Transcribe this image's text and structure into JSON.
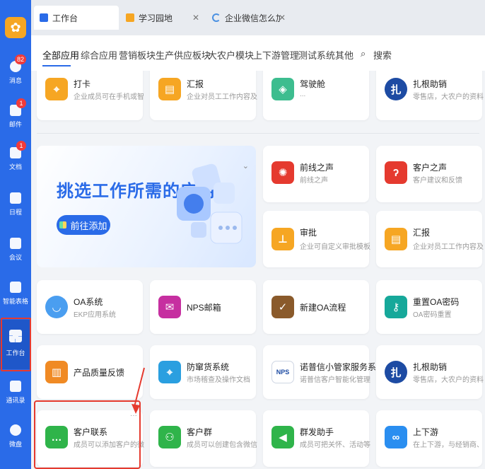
{
  "rail": {
    "items": [
      {
        "label": "消息",
        "badge": "82"
      },
      {
        "label": "邮件",
        "badge": "1"
      },
      {
        "label": "文档",
        "badge": "1"
      },
      {
        "label": "日程",
        "badge": ""
      },
      {
        "label": "会议",
        "badge": ""
      },
      {
        "label": "智能表格",
        "badge": ""
      },
      {
        "label": "工作台",
        "badge": ""
      },
      {
        "label": "通讯录",
        "badge": ""
      },
      {
        "label": "微盘",
        "badge": ""
      }
    ]
  },
  "tabs": [
    {
      "label": "工作台",
      "icon": "grid-icon",
      "color": "#2a6be8"
    },
    {
      "label": "学习园地",
      "icon": "app-icon",
      "color": "#f6a623"
    },
    {
      "label": "企业微信怎么加好友",
      "icon": "loading-icon",
      "color": "#4a90e2"
    }
  ],
  "categories": [
    "全部应用",
    "综合应用",
    "营销板块",
    "生产供应板块",
    "大农户模块",
    "上下游管理",
    "测试系统",
    "其他",
    "搜索"
  ],
  "top_apps": [
    {
      "title": "打卡",
      "desc": "企业成员可在手机或智能...",
      "color": "#f6a623",
      "icon": "location-icon"
    },
    {
      "title": "汇报",
      "desc": "企业对员工工作内容及过...",
      "color": "#f6a623",
      "icon": "report-icon"
    },
    {
      "title": "驾驶舱",
      "desc": "...",
      "color": "#3dbd8f",
      "icon": "map-icon"
    },
    {
      "title": "扎根助销",
      "desc": "零售店，大农户的资料管...",
      "color": "#1d4ba3",
      "icon": "zhagen-icon"
    }
  ],
  "banner": {
    "title": "挑选工作所需的应用",
    "button": "前往添加"
  },
  "apps": [
    {
      "title": "前线之声",
      "desc": "前线之声",
      "color": "#e53a2f",
      "icon": "voice-icon"
    },
    {
      "title": "客户之声",
      "desc": "客户建议和反馈",
      "color": "#e53a2f",
      "icon": "ear-icon"
    },
    {
      "title": "审批",
      "desc": "企业可自定义审批模板，...",
      "color": "#f6a623",
      "icon": "stamp-icon"
    },
    {
      "title": "汇报",
      "desc": "企业对员工工作内容及过...",
      "color": "#f6a623",
      "icon": "report-icon"
    },
    {
      "title": "OA系统",
      "desc": "EKP应用系统",
      "color": "#4a9ef0",
      "icon": "smile-icon"
    },
    {
      "title": "NPS邮箱",
      "desc": "",
      "color": "#c62fa0",
      "icon": "mail-icon"
    },
    {
      "title": "新建OA流程",
      "desc": "",
      "color": "#8a5a2b",
      "icon": "checklist-icon"
    },
    {
      "title": "重置OA密码",
      "desc": "OA密码重置",
      "color": "#16a89a",
      "icon": "key-icon"
    },
    {
      "title": "产品质量反馈",
      "desc": "",
      "color": "#f08a24",
      "icon": "clipboard-icon"
    },
    {
      "title": "防窜货系统",
      "desc": "市场稽查及操作文档",
      "color": "#2a9fe0",
      "icon": "pin-icon"
    },
    {
      "title": "诺普信小管家服务系统",
      "desc": "诺普信客户智能化管理系...",
      "color": "#ffffff",
      "icon": "nps-logo-icon"
    },
    {
      "title": "扎根助销",
      "desc": "零售店，大农户的资料管...",
      "color": "#1d4ba3",
      "icon": "zhagen-icon"
    },
    {
      "title": "客户联系",
      "desc": "成员可以添加客户的微信...",
      "color": "#2fb44a",
      "icon": "chat-icon"
    },
    {
      "title": "客户群",
      "desc": "成员可以创建包含微信用...",
      "color": "#2fb44a",
      "icon": "group-icon"
    },
    {
      "title": "群发助手",
      "desc": "成员可把关怀、活动等消...",
      "color": "#2fb44a",
      "icon": "megaphone-icon"
    },
    {
      "title": "上下游",
      "desc": "在上下游，与经销商、供...",
      "color": "#2a8ef0",
      "icon": "link-icon"
    }
  ]
}
